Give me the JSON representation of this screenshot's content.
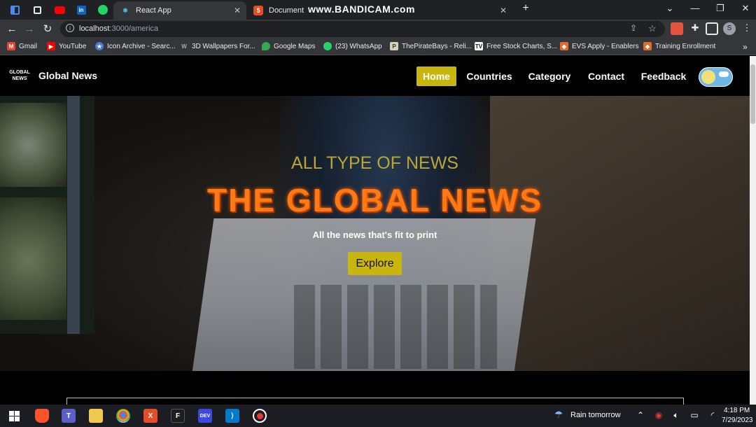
{
  "browser": {
    "tabs": [
      {
        "title": "React App",
        "active": true
      },
      {
        "title": "Document",
        "active": false
      }
    ],
    "watermark": "www.BANDICAM.com",
    "url_host": "localhost",
    "url_path": ":3000/america",
    "bookmarks": [
      {
        "label": "Gmail",
        "icon": "gmail-icon",
        "color": "#ea4335"
      },
      {
        "label": "YouTube",
        "icon": "youtube-icon",
        "color": "#ff0000"
      },
      {
        "label": "Icon Archive - Searc...",
        "icon": "star-icon",
        "color": "#4a7bd1"
      },
      {
        "label": "3D Wallpapers For...",
        "icon": "w-icon",
        "color": "#888888"
      },
      {
        "label": "Google Maps",
        "icon": "map-pin-icon",
        "color": "#34a853"
      },
      {
        "label": "(23) WhatsApp",
        "icon": "whatsapp-icon",
        "color": "#25d366"
      },
      {
        "label": "ThePirateBays - Reli...",
        "icon": "pirate-icon",
        "color": "#d9d0b8"
      },
      {
        "label": "Free Stock Charts, S...",
        "icon": "tv-icon",
        "color": "#111111"
      },
      {
        "label": "EVS Apply - Enablers",
        "icon": "evs-icon",
        "color": "#e06c2a"
      },
      {
        "label": "Training Enrollment",
        "icon": "training-icon",
        "color": "#e06c2a"
      }
    ]
  },
  "site": {
    "logo_line1": "GLOBAL",
    "logo_line2": "NEWS",
    "brand": "Global News",
    "nav": [
      "Home",
      "Countries",
      "Category",
      "Contact",
      "Feedback"
    ],
    "active_nav": "Home",
    "hero": {
      "kicker": "ALL TYPE OF NEWS",
      "title": "THE GLOBAL NEWS",
      "tagline": "All the news that's fit to print",
      "button": "Explore"
    }
  },
  "taskbar": {
    "weather": "Rain tomorrow",
    "time": "4:18 PM",
    "date": "7/29/2023"
  },
  "colors": {
    "accent_yellow": "#c8b60f",
    "title_orange": "#ff7a14",
    "kicker_olive": "#b8a734"
  }
}
